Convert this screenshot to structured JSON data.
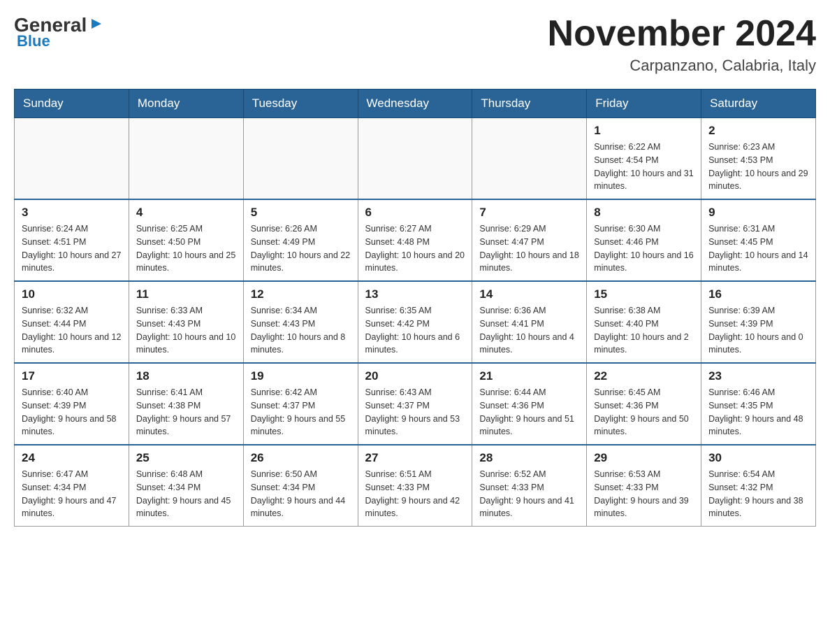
{
  "header": {
    "logo_general": "General",
    "logo_blue": "Blue",
    "month_title": "November 2024",
    "location": "Carpanzano, Calabria, Italy"
  },
  "weekdays": [
    "Sunday",
    "Monday",
    "Tuesday",
    "Wednesday",
    "Thursday",
    "Friday",
    "Saturday"
  ],
  "weeks": [
    [
      {
        "day": "",
        "info": ""
      },
      {
        "day": "",
        "info": ""
      },
      {
        "day": "",
        "info": ""
      },
      {
        "day": "",
        "info": ""
      },
      {
        "day": "",
        "info": ""
      },
      {
        "day": "1",
        "info": "Sunrise: 6:22 AM\nSunset: 4:54 PM\nDaylight: 10 hours and 31 minutes."
      },
      {
        "day": "2",
        "info": "Sunrise: 6:23 AM\nSunset: 4:53 PM\nDaylight: 10 hours and 29 minutes."
      }
    ],
    [
      {
        "day": "3",
        "info": "Sunrise: 6:24 AM\nSunset: 4:51 PM\nDaylight: 10 hours and 27 minutes."
      },
      {
        "day": "4",
        "info": "Sunrise: 6:25 AM\nSunset: 4:50 PM\nDaylight: 10 hours and 25 minutes."
      },
      {
        "day": "5",
        "info": "Sunrise: 6:26 AM\nSunset: 4:49 PM\nDaylight: 10 hours and 22 minutes."
      },
      {
        "day": "6",
        "info": "Sunrise: 6:27 AM\nSunset: 4:48 PM\nDaylight: 10 hours and 20 minutes."
      },
      {
        "day": "7",
        "info": "Sunrise: 6:29 AM\nSunset: 4:47 PM\nDaylight: 10 hours and 18 minutes."
      },
      {
        "day": "8",
        "info": "Sunrise: 6:30 AM\nSunset: 4:46 PM\nDaylight: 10 hours and 16 minutes."
      },
      {
        "day": "9",
        "info": "Sunrise: 6:31 AM\nSunset: 4:45 PM\nDaylight: 10 hours and 14 minutes."
      }
    ],
    [
      {
        "day": "10",
        "info": "Sunrise: 6:32 AM\nSunset: 4:44 PM\nDaylight: 10 hours and 12 minutes."
      },
      {
        "day": "11",
        "info": "Sunrise: 6:33 AM\nSunset: 4:43 PM\nDaylight: 10 hours and 10 minutes."
      },
      {
        "day": "12",
        "info": "Sunrise: 6:34 AM\nSunset: 4:43 PM\nDaylight: 10 hours and 8 minutes."
      },
      {
        "day": "13",
        "info": "Sunrise: 6:35 AM\nSunset: 4:42 PM\nDaylight: 10 hours and 6 minutes."
      },
      {
        "day": "14",
        "info": "Sunrise: 6:36 AM\nSunset: 4:41 PM\nDaylight: 10 hours and 4 minutes."
      },
      {
        "day": "15",
        "info": "Sunrise: 6:38 AM\nSunset: 4:40 PM\nDaylight: 10 hours and 2 minutes."
      },
      {
        "day": "16",
        "info": "Sunrise: 6:39 AM\nSunset: 4:39 PM\nDaylight: 10 hours and 0 minutes."
      }
    ],
    [
      {
        "day": "17",
        "info": "Sunrise: 6:40 AM\nSunset: 4:39 PM\nDaylight: 9 hours and 58 minutes."
      },
      {
        "day": "18",
        "info": "Sunrise: 6:41 AM\nSunset: 4:38 PM\nDaylight: 9 hours and 57 minutes."
      },
      {
        "day": "19",
        "info": "Sunrise: 6:42 AM\nSunset: 4:37 PM\nDaylight: 9 hours and 55 minutes."
      },
      {
        "day": "20",
        "info": "Sunrise: 6:43 AM\nSunset: 4:37 PM\nDaylight: 9 hours and 53 minutes."
      },
      {
        "day": "21",
        "info": "Sunrise: 6:44 AM\nSunset: 4:36 PM\nDaylight: 9 hours and 51 minutes."
      },
      {
        "day": "22",
        "info": "Sunrise: 6:45 AM\nSunset: 4:36 PM\nDaylight: 9 hours and 50 minutes."
      },
      {
        "day": "23",
        "info": "Sunrise: 6:46 AM\nSunset: 4:35 PM\nDaylight: 9 hours and 48 minutes."
      }
    ],
    [
      {
        "day": "24",
        "info": "Sunrise: 6:47 AM\nSunset: 4:34 PM\nDaylight: 9 hours and 47 minutes."
      },
      {
        "day": "25",
        "info": "Sunrise: 6:48 AM\nSunset: 4:34 PM\nDaylight: 9 hours and 45 minutes."
      },
      {
        "day": "26",
        "info": "Sunrise: 6:50 AM\nSunset: 4:34 PM\nDaylight: 9 hours and 44 minutes."
      },
      {
        "day": "27",
        "info": "Sunrise: 6:51 AM\nSunset: 4:33 PM\nDaylight: 9 hours and 42 minutes."
      },
      {
        "day": "28",
        "info": "Sunrise: 6:52 AM\nSunset: 4:33 PM\nDaylight: 9 hours and 41 minutes."
      },
      {
        "day": "29",
        "info": "Sunrise: 6:53 AM\nSunset: 4:33 PM\nDaylight: 9 hours and 39 minutes."
      },
      {
        "day": "30",
        "info": "Sunrise: 6:54 AM\nSunset: 4:32 PM\nDaylight: 9 hours and 38 minutes."
      }
    ]
  ]
}
